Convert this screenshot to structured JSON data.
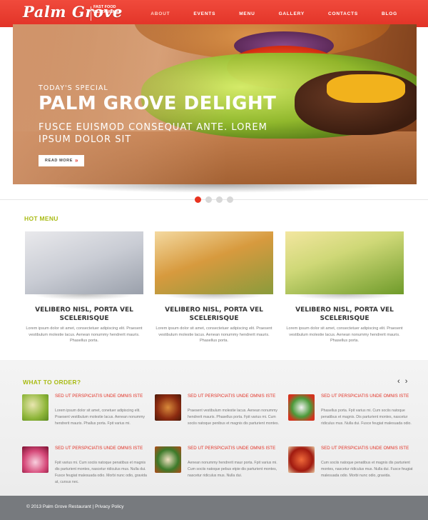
{
  "header": {
    "logo": "Palm Grove",
    "tagline": "FAST FOOD RESTAURANT",
    "nav": [
      "ABOUT",
      "EVENTS",
      "MENU",
      "GALLERY",
      "CONTACTS",
      "BLOG"
    ],
    "active_nav": "ABOUT"
  },
  "hero": {
    "subtitle": "TODAY'S SPECIAL",
    "title": "PALM GROVE DELIGHT",
    "description": "FUSCE EUISMOD CONSEQUAT ANTE. LOREM IPSUM DOLOR SIT",
    "button_label": "READ MORE",
    "button_arrow": "»",
    "slides": 4,
    "active_slide": 1
  },
  "hot_menu": {
    "title": "HOT MENU",
    "items": [
      {
        "name": "VELIBERO NISL, PORTA VEL SCELERISQUE",
        "text": "Lorem ipsum dolor sit amet, consectetuer adipiscing elit. Praesent vestibulum molestie lacus. Aenean nonummy hendrerit mauris. Phasellus porta."
      },
      {
        "name": "VELIBERO NISL, PORTA VEL SCELERISQUE",
        "text": "Lorem ipsum dolor sit amet, consectetuer adipiscing elit. Praesent vestibulum molestie lacus. Aenean nonummy hendrerit mauris. Phasellus porta."
      },
      {
        "name": "VELIBERO NISL, PORTA VEL SCELERISQUE",
        "text": "Lorem ipsum dolor sit amet, consectetuer adipiscing elit. Praesent vestibulum molestie lacus. Aenean nonummy hendrerit mauris. Phasellus porta."
      }
    ]
  },
  "what_to_order": {
    "title": "WHAT TO ORDER?",
    "nav_label": "‹ ›",
    "items": [
      {
        "head": "SED UT PERSPICIATIS UNDE OMNIS ISTE",
        "text": "Lorem ipsum dolor sit amet, conetuer adipiscing elit. Praesent vestibulum molestie lacus. Aenean nonummy hendrerit mauris. Phallus porta. Fpit varius mi."
      },
      {
        "head": "SED UT PERSPICIATIS UNDE OMNIS ISTE",
        "text": "Praesent vestibulum molestie lacus. Aenean nonummy hendrerit mauris. Phasellus porta. Fpit varius mi. Cum sociis natoque penibus et magnis dis parturient montes."
      },
      {
        "head": "SED UT PERSPICIATIS UNDE OMNIS ISTE",
        "text": "Phasellus porta. Fpit varius mi. Cum sociis natoque penatibus et magnis. Dis parturient montes, nascetur ridiculus mus. Nulla dui. Fusce feugiat malesuada odio."
      },
      {
        "head": "SED UT PERSPICIATIS UNDE OMNIS ISTE",
        "text": "Fpit varius mi. Cum sociis natoque penatibus et magnis dis parturient montes, nascetur ridiculus mus. Nulla dui. Fusce feugiat malesuada odio. Morbi nunc odio, gravida at, cursus nec."
      },
      {
        "head": "SED UT PERSPICIATIS UNDE OMNIS ISTE",
        "text": "Aenean nonummy hendrerit maur porta. Fpit varius mi. Cum sociis natoque pebus etpie dis parturient montes, nascetur ridiculus mus. Nulla dui."
      },
      {
        "head": "SED UT PERSPICIATIS UNDE OMNIS ISTE",
        "text": "Cum sociis natoque penatibus et magnis dis parturient montes, nascetur ridiculus mus. Nulla dui. Fusce feugiat malesuada odio. Morbi nunc odio, gravida."
      }
    ]
  },
  "footer": {
    "text": "© 2013 Palm Grove Restaurant | Privacy Policy"
  },
  "colors": {
    "accent_red": "#e23327",
    "section_title_green": "#a9bb14"
  }
}
